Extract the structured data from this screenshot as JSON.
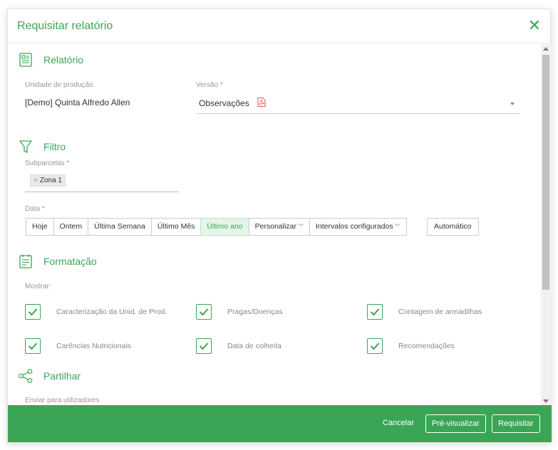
{
  "dialog": {
    "title": "Requisitar relatório"
  },
  "report": {
    "heading": "Relatório",
    "unit_label": "Unidade de produção",
    "unit_value": "[Demo] Quinta Alfredo Allen",
    "version_label": "Versão *",
    "version_value": "Observações"
  },
  "filter": {
    "heading": "Filtro",
    "subplots_label": "Subparcelas *",
    "tags": [
      "Zona 1"
    ],
    "date_label": "Data *",
    "date_options": [
      "Hoje",
      "Ontem",
      "Última Semana",
      "Último Mês",
      "Último ano",
      "Personalizar",
      "Intervalos configurados"
    ],
    "date_selected": "Último ano",
    "auto_label": "Automático"
  },
  "formatting": {
    "heading": "Formatação",
    "show_label": "Mostrar:",
    "options": [
      {
        "label": "Caracterização da Unid. de Prod.",
        "checked": true
      },
      {
        "label": "Pragas/Doenças",
        "checked": true
      },
      {
        "label": "Contagem de armadilhas",
        "checked": true
      },
      {
        "label": "Carências Nutricionais",
        "checked": true
      },
      {
        "label": "Data de colheita",
        "checked": true
      },
      {
        "label": "Recomendações",
        "checked": true
      }
    ]
  },
  "share": {
    "heading": "Partilhar",
    "send_label": "Enviar para utilizadores"
  },
  "footer": {
    "cancel": "Cancelar",
    "preview": "Pré-visualizar",
    "submit": "Requisitar"
  },
  "colors": {
    "accent": "#3aa655",
    "pdf": "#e25a4f"
  }
}
